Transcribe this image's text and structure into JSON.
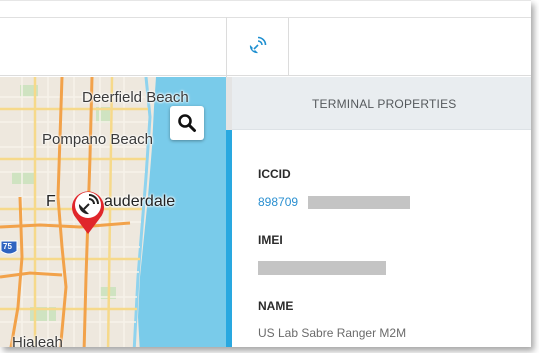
{
  "colors": {
    "accent": "#29a8e0",
    "link": "#2a8fd0",
    "marker_red": "#e0262b",
    "header_bg": "#e9edf0",
    "water": "#79cbea"
  },
  "toolbar": {
    "tab_icon": "satellite-dish-icon"
  },
  "map": {
    "labels": {
      "deerfield": "Deerfield Beach",
      "pompano": "Pompano Beach",
      "fort_left": "F",
      "fort_right": "auderdale",
      "hialeah": "Hialeah",
      "shield_75": "75"
    },
    "search_icon": "search-icon",
    "marker_icon": "satellite-dish-icon"
  },
  "panel": {
    "title": "TERMINAL PROPERTIES",
    "properties": [
      {
        "label": "ICCID",
        "value": "898709",
        "redacted": true
      },
      {
        "label": "IMEI",
        "value": "",
        "redacted": true
      },
      {
        "label": "NAME",
        "value": "US Lab Sabre Ranger M2M",
        "redacted": false
      }
    ]
  }
}
